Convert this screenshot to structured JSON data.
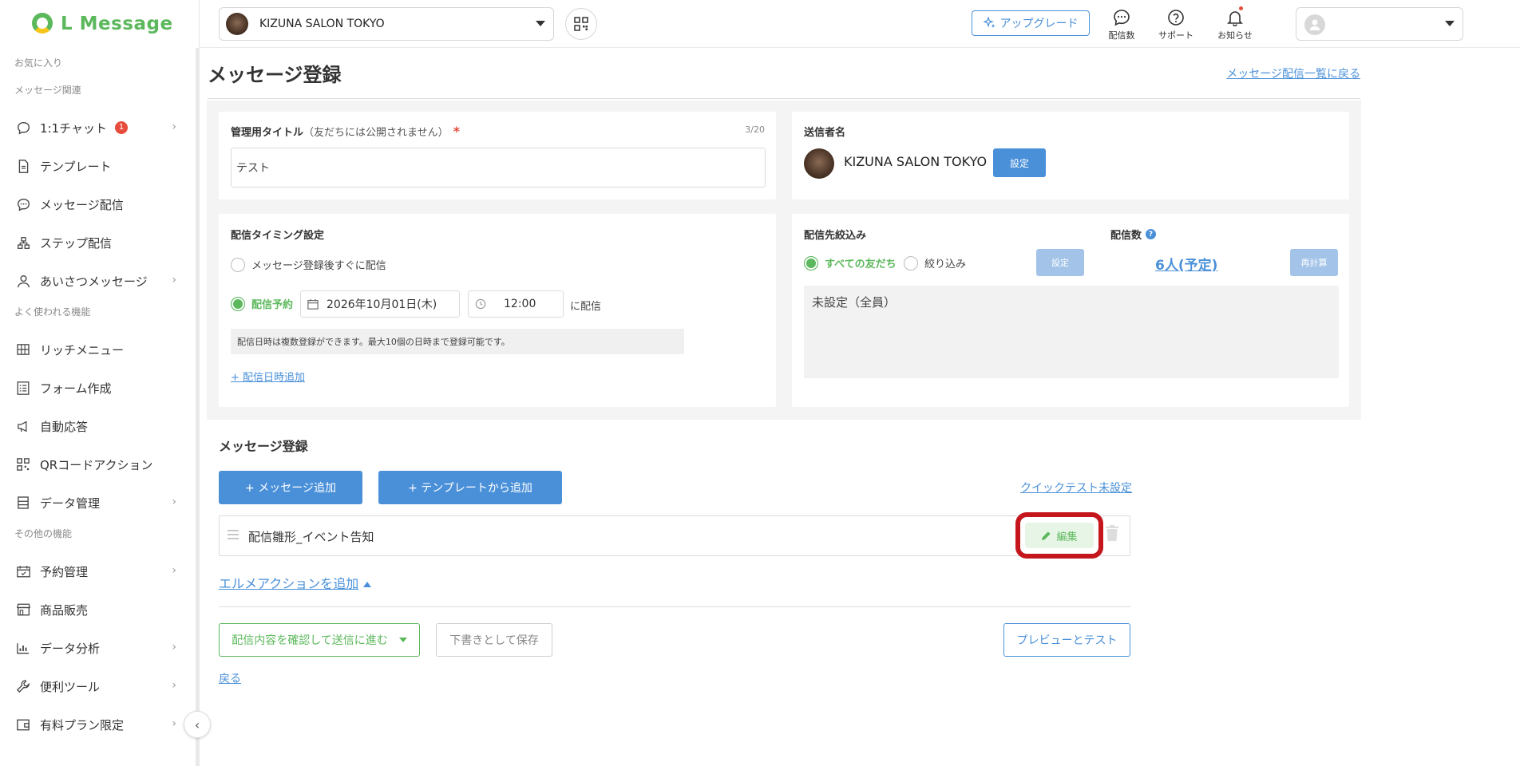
{
  "app": {
    "logo_text": "L Message",
    "brand_color": "#5cb85c",
    "accent_color": "#4a90d9"
  },
  "header": {
    "account_name": "KIZUNA SALON TOKYO",
    "upgrade_label": "アップグレード",
    "icons": [
      {
        "name": "chat-bubble-icon",
        "label": "配信数"
      },
      {
        "name": "question-icon",
        "label": "サポート"
      },
      {
        "name": "bell-icon",
        "label": "お知らせ"
      }
    ]
  },
  "sidebar": {
    "sections": {
      "favorites": "お気に入り",
      "message": "メッセージ関連",
      "frequent": "よく使われる機能",
      "other": "その他の機能"
    },
    "items": {
      "chat": {
        "label": "1:1チャット",
        "badge": "1"
      },
      "template": {
        "label": "テンプレート"
      },
      "broadcast": {
        "label": "メッセージ配信"
      },
      "step": {
        "label": "ステップ配信"
      },
      "greeting": {
        "label": "あいさつメッセージ"
      },
      "richmenu": {
        "label": "リッチメニュー"
      },
      "form": {
        "label": "フォーム作成"
      },
      "autoreply": {
        "label": "自動応答"
      },
      "qr": {
        "label": "QRコードアクション"
      },
      "data": {
        "label": "データ管理"
      },
      "reservation": {
        "label": "予約管理"
      },
      "sales": {
        "label": "商品販売"
      },
      "analysis": {
        "label": "データ分析"
      },
      "tools": {
        "label": "便利ツール"
      },
      "paid": {
        "label": "有料プラン限定"
      }
    }
  },
  "page": {
    "title": "メッセージ登録",
    "back_to_list": "メッセージ配信一覧に戻る"
  },
  "admin_title": {
    "label": "管理用タイトル",
    "note": "（友だちには公開されません）",
    "required_mark": "*",
    "counter": "3/20",
    "value": "テスト"
  },
  "sender": {
    "label": "送信者名",
    "name": "KIZUNA SALON TOKYO",
    "set_button": "設定"
  },
  "timing": {
    "label": "配信タイミング設定",
    "option_immediate": "メッセージ登録後すぐに配信",
    "option_scheduled": "配信予約",
    "date": "2026年10月01日(木)",
    "time": "12:00",
    "suffix": "に配信",
    "note": "配信日時は複数登録ができます。最大10個の日時まで登録可能です。",
    "add_link": "+ 配信日時追加"
  },
  "target": {
    "label": "配信先絞込み",
    "option_all": "すべての友だち",
    "option_filter": "絞り込み",
    "set_button": "設定",
    "summary": "未設定（全員）"
  },
  "count": {
    "label": "配信数",
    "value": "6人(予定)",
    "recalc_button": "再計算"
  },
  "messages": {
    "section_title": "メッセージ登録",
    "add_message": "+ メッセージ追加",
    "add_from_template": "+ テンプレートから追加",
    "quick_test": "クイックテスト未設定",
    "items": [
      {
        "name": "配信雛形_イベント告知",
        "edit_label": "編集"
      }
    ],
    "add_action": "エルメアクションを追加"
  },
  "footer": {
    "confirm_send": "配信内容を確認して送信に進む",
    "save_draft": "下書きとして保存",
    "preview_test": "プレビューとテスト",
    "back": "戻る"
  }
}
